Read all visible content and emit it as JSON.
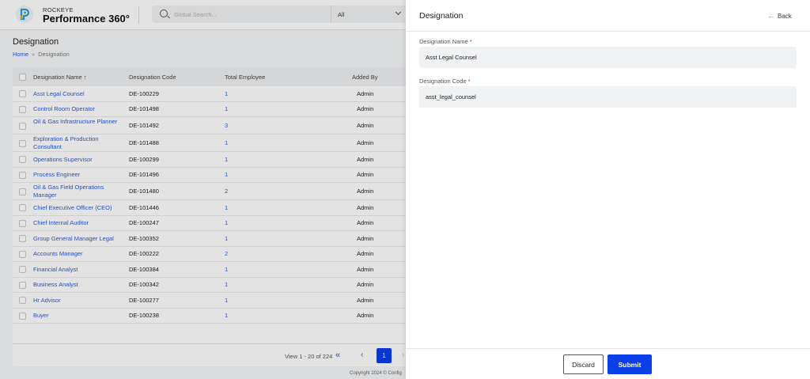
{
  "header": {
    "brand_top": "ROCKEYE",
    "brand_name": "Performance 360°",
    "search_placeholder": "Global Search...",
    "scope": "All"
  },
  "page": {
    "title": "Designation",
    "breadcrumb_home": "Home",
    "breadcrumb_sep": "»",
    "breadcrumb_current": "Designation"
  },
  "table": {
    "columns": [
      "Designation Name",
      "Designation Code",
      "Total Employee",
      "Added By"
    ],
    "sort_indicator": "↑",
    "rows": [
      {
        "name": "Asst Legal Counsel",
        "code": "DE-100229",
        "total": "1",
        "added_by": "Admin"
      },
      {
        "name": "Control Room Operator",
        "code": "DE-101498",
        "total": "1",
        "added_by": "Admin"
      },
      {
        "name": "Oil & Gas Infrastructure Planner",
        "code": "DE-101492",
        "total": "3",
        "added_by": "Admin"
      },
      {
        "name": "Exploration & Production Consultant",
        "code": "DE-101488",
        "total": "1",
        "added_by": "Admin"
      },
      {
        "name": "Operations Supervisor",
        "code": "DE-100299",
        "total": "1",
        "added_by": "Admin"
      },
      {
        "name": "Process Engineer",
        "code": "DE-101496",
        "total": "1",
        "added_by": "Admin"
      },
      {
        "name": "Oil & Gas Field Operations Manager",
        "code": "DE-101480",
        "total": "2",
        "added_by": "Admin"
      },
      {
        "name": "Chief Executive Officer (CEO)",
        "code": "DE-101446",
        "total": "1",
        "added_by": "Admin"
      },
      {
        "name": "Chief Internal Auditor",
        "code": "DE-100247",
        "total": "1",
        "added_by": "Admin"
      },
      {
        "name": "Group General Manager Legal",
        "code": "DE-100352",
        "total": "1",
        "added_by": "Admin"
      },
      {
        "name": "Accounts Manager",
        "code": "DE-100222",
        "total": "2",
        "added_by": "Admin"
      },
      {
        "name": "Financial Analyst",
        "code": "DE-100384",
        "total": "1",
        "added_by": "Admin"
      },
      {
        "name": "Business Analyst",
        "code": "DE-100342",
        "total": "1",
        "added_by": "Admin"
      },
      {
        "name": "Hr Advisor",
        "code": "DE-100277",
        "total": "1",
        "added_by": "Admin"
      },
      {
        "name": "Buyer",
        "code": "DE-100238",
        "total": "1",
        "added_by": "Admin"
      }
    ],
    "pager_text": "View 1 - 20 of 224",
    "pager_first": "«",
    "pager_prev": "‹",
    "current_page": "1",
    "pager_next": "›"
  },
  "footer": {
    "copyright": "Copyright 2024 © Config"
  },
  "panel": {
    "title": "Designation",
    "back_label": "Back",
    "back_arrow": "←",
    "name_label": "Designation Name",
    "name_value": "Asst Legal Counsel",
    "code_label": "Designation Code",
    "code_value": "asst_legal_counsel",
    "required_mark": "*",
    "discard_label": "Discard",
    "submit_label": "Submit"
  },
  "colors": {
    "accent": "#0b3fe8",
    "link": "#2a5bd7",
    "required": "#e02424"
  }
}
